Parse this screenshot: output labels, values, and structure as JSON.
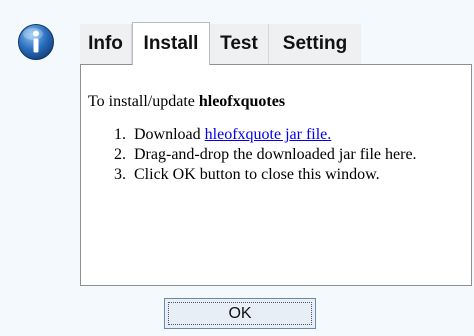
{
  "dialog": {
    "icon": "info-icon",
    "tabs": [
      {
        "label": "Info",
        "active": false
      },
      {
        "label": "Install",
        "active": true
      },
      {
        "label": "Test",
        "active": false
      },
      {
        "label": "Setting",
        "active": false
      }
    ],
    "install": {
      "intro_prefix": "To install/update ",
      "product_name": "hleofxquotes",
      "steps": [
        {
          "number": "1.",
          "prefix": "Download ",
          "link": "hleofxquote jar file."
        },
        {
          "number": "2.",
          "text": "Drag-and-drop the downloaded jar file here."
        },
        {
          "number": "3.",
          "text": "Click OK button to close this window."
        }
      ]
    },
    "ok_label": "OK"
  },
  "colors": {
    "background": "#f3f9fd",
    "link": "#0000ee",
    "info_icon_blue": "#1d5fa8"
  }
}
